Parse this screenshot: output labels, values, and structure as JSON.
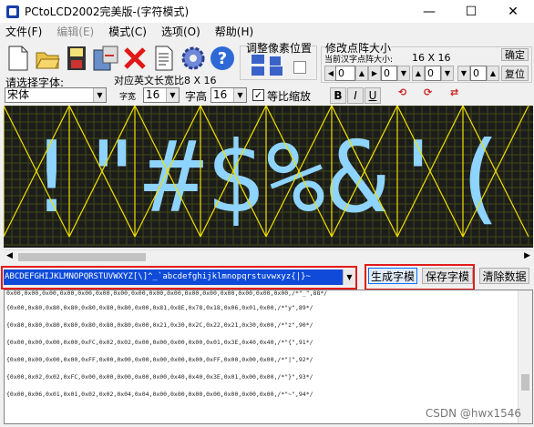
{
  "window": {
    "title": "PCtoLCD2002完美版-(字符模式)",
    "minimize": "—",
    "maximize": "☐",
    "close": "✕"
  },
  "menu": [
    {
      "label": "文件(F)",
      "dim": false
    },
    {
      "label": "编辑(E)",
      "dim": true
    },
    {
      "label": "模式(C)",
      "dim": false
    },
    {
      "label": "选项(O)",
      "dim": false
    },
    {
      "label": "帮助(H)",
      "dim": false
    }
  ],
  "toolbar": {
    "icons": [
      "new-file-icon",
      "open-folder-icon",
      "save-icon",
      "export-icon",
      "delete-icon",
      "document-icon",
      "settings-icon",
      "help-icon"
    ]
  },
  "pixel_adjust": {
    "title": "调整像素位置"
  },
  "dot_resize": {
    "title": "修改点阵大小",
    "subtitle": "当前汉字点阵大小:",
    "size": "16 X 16",
    "confirm": "确定",
    "reset": "复位",
    "values": [
      "0",
      "0",
      "0",
      "0"
    ]
  },
  "font_panel": {
    "font_label": "请选择字体:",
    "font_value": "宋体",
    "ratio_label": "对应英文长宽比8 X 16",
    "width_label": "字宽",
    "width_value": "16",
    "height_label": "字高",
    "height_value": "16",
    "equal_scale_label": "等比缩放",
    "equal_scale_checked": true
  },
  "style_buttons": [
    "B",
    "I",
    "U"
  ],
  "canvas": {
    "chars": "!\"#$%&'(",
    "grid_color": "#3f4a12",
    "on_color": "#8fd4ff",
    "bg_color": "#1c1c1c",
    "line_color": "#f0e000"
  },
  "input_text": "ABCDEFGHIJKLMNOPQRSTUVWXYZ[\\]^_`abcdefghijklmnopqrstuvwxyz{|}~",
  "buttons": {
    "generate": "生成字模",
    "save": "保存字模",
    "clear": "清除数据"
  },
  "output_lines": [
    "0x00,0x00,0x00,0x00,0x00,0x00,0x00,0x00,0x00,0x00,0x00,0x00,0x00,0x00,0x00,0x00,/*\"_\",88*/",
    "{0x00,0x80,0x80,0x80,0x80,0x80,0x80,0x00,0x81,0x8E,0x78,0x18,0x06,0x01,0x00,/*\"y\",89*/",
    "{0x80,0x80,0x80,0x80,0x80,0x80,0x80,0x00,0x21,0x30,0x2C,0x22,0x21,0x30,0x00,/*\"z\",90*/",
    "{0x00,0x00,0x00,0x00,0xFC,0x02,0x02,0x00,0x00,0x00,0x00,0x01,0x3E,0x40,0x40,/*\"{\",91*/",
    "{0x00,0x00,0x00,0x00,0xFF,0x00,0x00,0x00,0x00,0x00,0x00,0xFF,0x00,0x00,0x00,/*\"|\",92*/",
    "{0x00,0x02,0x02,0xFC,0x00,0x00,0x00,0x00,0x00,0x40,0x40,0x3E,0x01,0x00,0x00,/*\"}\",93*/",
    "{0x00,0x06,0x01,0x01,0x02,0x02,0x04,0x04,0x00,0x00,0x00,0x00,0x00,0x00,0x00,/*\"~\",94*/"
  ],
  "watermark": "CSDN @hwx1546"
}
